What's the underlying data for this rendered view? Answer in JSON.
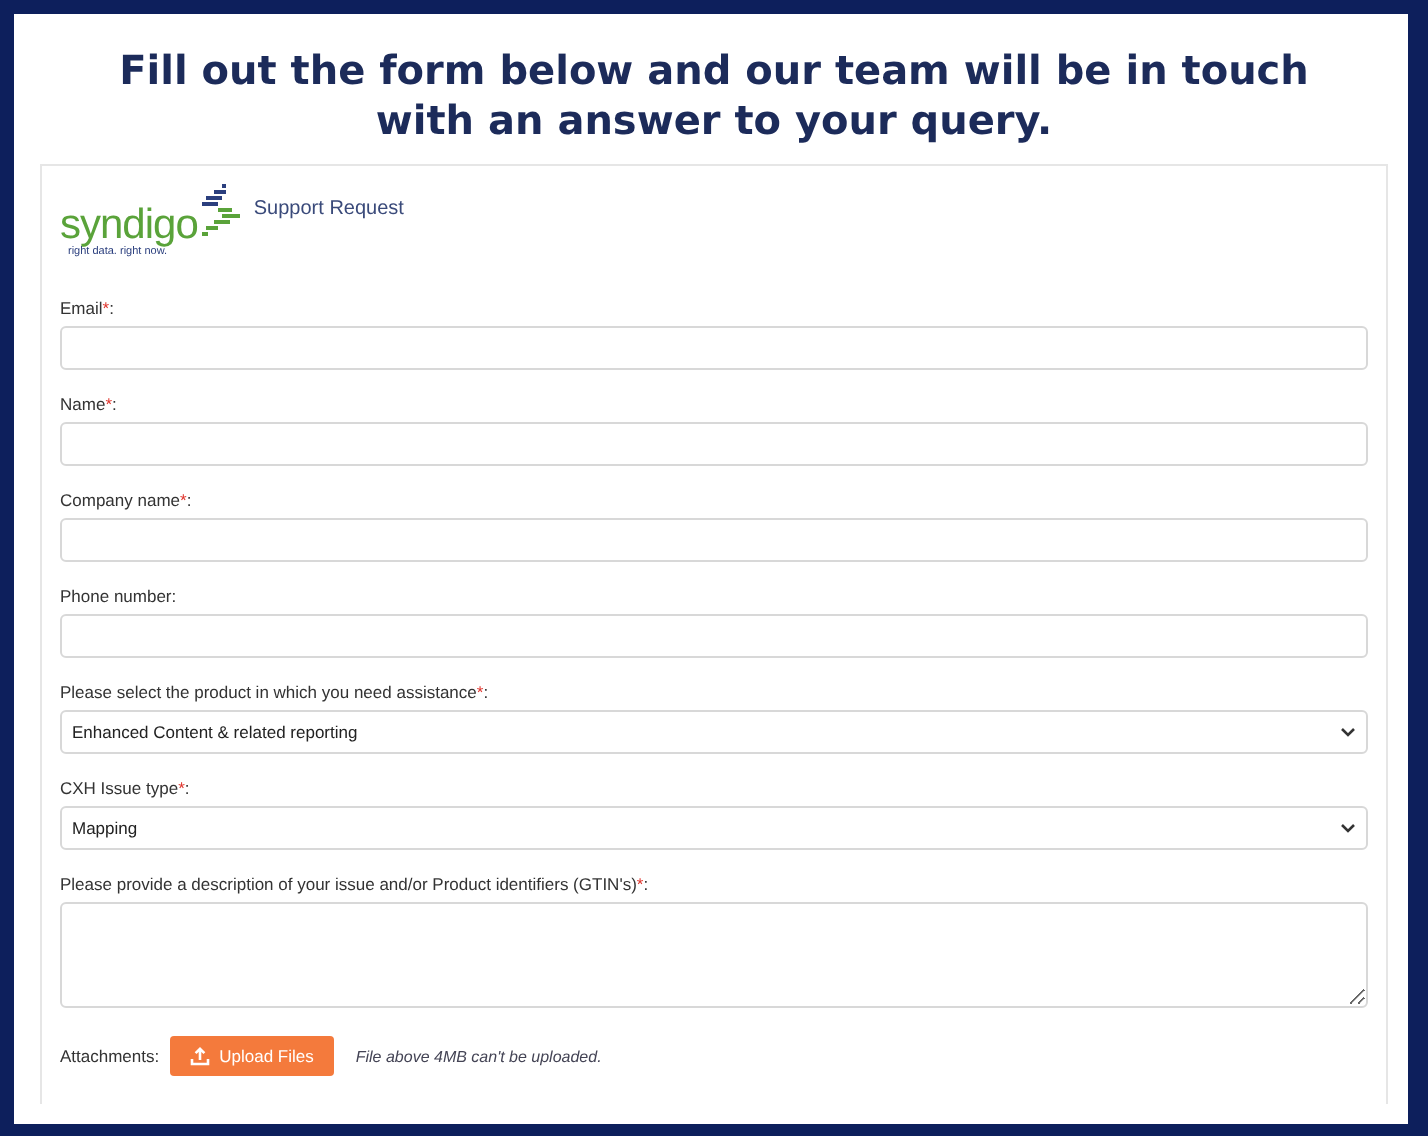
{
  "heading": "Fill out the form below and our team will be in touch with an answer to your query.",
  "form": {
    "logo": {
      "wordmark": "syndigo",
      "tagline": "right data. right now."
    },
    "title": "Support Request",
    "fields": [
      {
        "kind": "text",
        "label": "Email",
        "required_mark": "*",
        "label_end": ":"
      },
      {
        "kind": "text",
        "label": "Name",
        "required_mark": "*",
        "label_end": ":"
      },
      {
        "kind": "text",
        "label": "Company name",
        "required_mark": "*",
        "label_end": ":"
      },
      {
        "kind": "text",
        "label": "Phone number",
        "label_end": ":"
      },
      {
        "kind": "select",
        "label": "Please select the product in which you need assistance",
        "required_mark": "*",
        "label_end": ":",
        "value": "Enhanced Content & related reporting"
      },
      {
        "kind": "select",
        "label": "CXH Issue type",
        "required_mark": "*",
        "label_end": ":",
        "value": "Mapping"
      },
      {
        "kind": "textarea",
        "label": "Please provide a description of your issue and/or Product identifiers (GTIN's)",
        "required_mark": "*",
        "label_end": ":"
      }
    ],
    "attachments": {
      "label": "Attachments:",
      "button": "Upload Files",
      "note": "File above 4MB can't be uploaded."
    }
  }
}
